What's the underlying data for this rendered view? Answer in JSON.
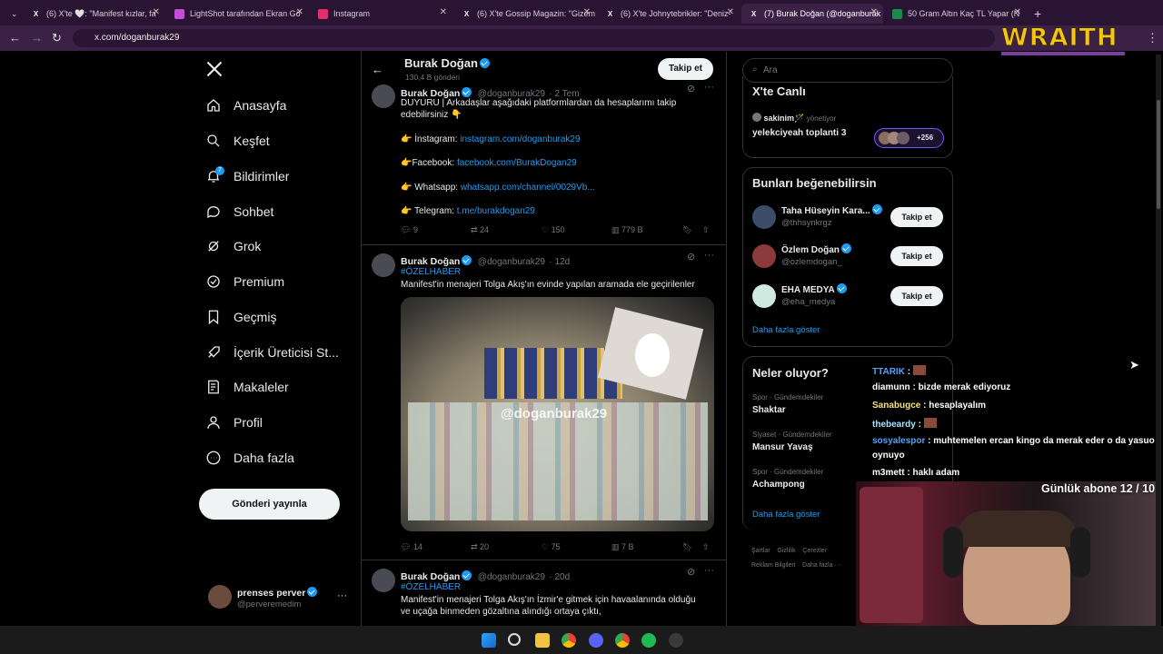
{
  "browser": {
    "tabs": [
      {
        "label": "(6) X'te 🤍: \"Manifest kızlar, fa",
        "fav": "X"
      },
      {
        "label": "LightShot tarafından Ekran Gö",
        "fav": "L"
      },
      {
        "label": "Instagram",
        "fav": "◎"
      },
      {
        "label": "(6) X'te Gossip Magazin: \"Gizem",
        "fav": "X"
      },
      {
        "label": "(6) X'te Johnytebrikler: \"Deniz-",
        "fav": "X"
      },
      {
        "label": "(7) Burak Doğan (@doganburak",
        "fav": "X"
      },
      {
        "label": "50 Gram Altın Kaç TL Yapar (N",
        "fav": "S"
      }
    ],
    "url": "x.com/doganburak29",
    "overlay_logo": "WRAITH"
  },
  "nav": {
    "items": [
      {
        "label": "Anasayfa",
        "icon": "home-icon"
      },
      {
        "label": "Keşfet",
        "icon": "search-icon"
      },
      {
        "label": "Bildirimler",
        "icon": "bell-icon",
        "badge": "7"
      },
      {
        "label": "Sohbet",
        "icon": "chat-icon"
      },
      {
        "label": "Grok",
        "icon": "grok-icon"
      },
      {
        "label": "Premium",
        "icon": "premium-icon"
      },
      {
        "label": "Geçmiş",
        "icon": "bookmark-icon"
      },
      {
        "label": "İçerik Üreticisi St...",
        "icon": "rocket-icon"
      },
      {
        "label": "Makaleler",
        "icon": "article-icon"
      },
      {
        "label": "Profil",
        "icon": "person-icon"
      },
      {
        "label": "Daha fazla",
        "icon": "more-icon"
      }
    ],
    "post_button": "Gönderi yayınla",
    "account": {
      "name": "prenses perver",
      "handle": "@perveremedim"
    }
  },
  "profile_header": {
    "name": "Burak Doğan",
    "posts": "130,4 B gönderi",
    "follow": "Takip et"
  },
  "tweets": [
    {
      "name": "Burak Doğan",
      "handle": "@doganburak29",
      "time": "· 2 Tem",
      "lines": [
        "DUYURU | Arkadaşlar aşağıdaki platformlardan da hesaplarımı takip",
        "edebilirsiniz 👇"
      ],
      "links": [
        {
          "prefix": "👉 İnstagram: ",
          "url": "instagram.com/doganburak29"
        },
        {
          "prefix": "👉Facebook: ",
          "url": "facebook.com/BurakDogan29"
        },
        {
          "prefix": "👉 Whatsapp: ",
          "url": "whatsapp.com/channel/0029Vb..."
        },
        {
          "prefix": "👉 Telegram: ",
          "url": "t.me/burakdogan29"
        }
      ],
      "stats": {
        "replies": "9",
        "retweets": "24",
        "likes": "150",
        "views": "779 B"
      }
    },
    {
      "name": "Burak Doğan",
      "handle": "@doganburak29",
      "time": "· 12d",
      "hashtag": "#ÖZELHABER",
      "text": "Manifest'in menajeri Tolga Akış'ın evinde yapılan aramada ele geçirilenler",
      "watermark": "@doganburak29",
      "stats": {
        "replies": "14",
        "retweets": "20",
        "likes": "75",
        "views": "7 B"
      }
    },
    {
      "name": "Burak Doğan",
      "handle": "@doganburak29",
      "time": "· 20d",
      "hashtag": "#ÖZELHABER",
      "lines": [
        "Manifest'in menajeri Tolga Akış'ın İzmir'e gitmek için havaalanında olduğu",
        "ve uçağa binmeden gözaltına alındığı ortaya çıktı,"
      ]
    }
  ],
  "right": {
    "search_placeholder": "Ara",
    "live": {
      "title": "X'te Canlı",
      "host": "sakinim🪄",
      "host_role": "yönetiyor",
      "space": "yelekciyeah toplanti 3",
      "count": "+256"
    },
    "suggest": {
      "title": "Bunları beğenebilirsin",
      "users": [
        {
          "name": "Taha Hüseyin Kara...",
          "handle": "@thhsynkrgz"
        },
        {
          "name": "Özlem Doğan",
          "handle": "@ozlemdogan_"
        },
        {
          "name": "EHA MEDYA",
          "handle": "@eha_medya"
        }
      ],
      "follow": "Takip et",
      "more": "Daha fazla göster"
    },
    "trends": {
      "title": "Neler oluyor?",
      "items": [
        {
          "cat": "Spor · Gündemdekiler",
          "name": "Shaktar"
        },
        {
          "cat": "Siyaset · Gündemdekiler",
          "name": "Mansur Yavaş"
        },
        {
          "cat": "Spor · Gündemdekiler",
          "name": "Achampong"
        }
      ],
      "more": "Daha fazla göster"
    },
    "footer": [
      "Şartlar",
      "Gizlilik",
      "Çerezler",
      "Reklam Bilgileri",
      "Daha fazla ···"
    ]
  },
  "stream": {
    "chat": [
      {
        "user": "TTARIK",
        "msg": ""
      },
      {
        "user": "diamunn",
        "msg": "bizde merak ediyoruz"
      },
      {
        "user": "Sanabugce",
        "msg": "hesaplayalım"
      },
      {
        "user": "thebeardy",
        "msg": ""
      },
      {
        "user": "sosyalespor",
        "msg": "muhtemelen ercan kingo da merak eder o da yasuo"
      },
      {
        "user": "",
        "msg": "oynuyo"
      },
      {
        "user": "m3mett",
        "msg": "haklı adam"
      }
    ],
    "sub_counter": "Günlük abone 12 / 10"
  }
}
